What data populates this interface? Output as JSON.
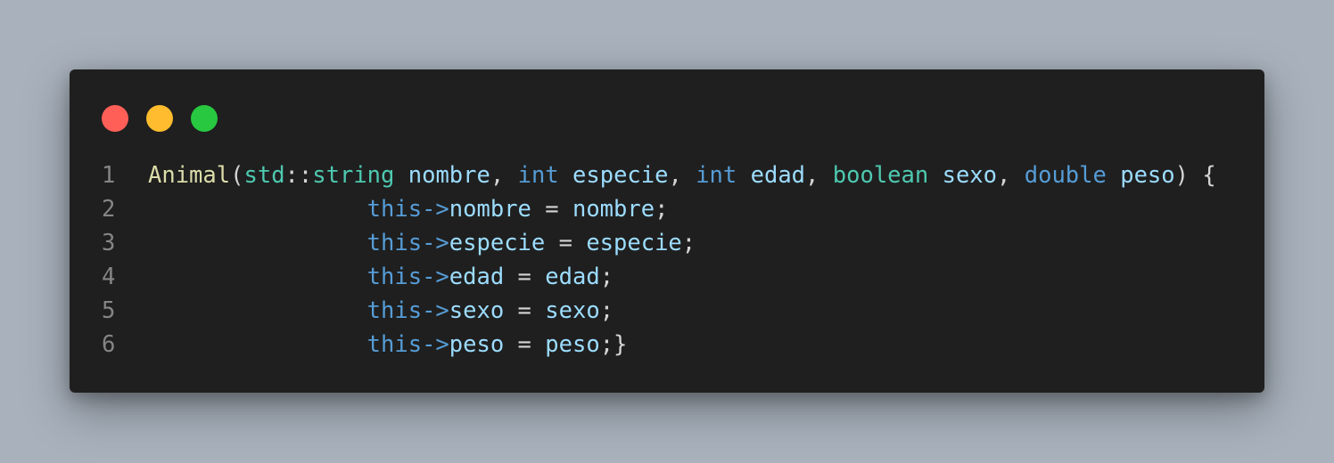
{
  "window": {
    "traffic_lights": {
      "close_color": "#ff5f57",
      "minimize_color": "#febc2e",
      "maximize_color": "#28c840"
    }
  },
  "code": {
    "lines": [
      {
        "number": "1",
        "tokens": [
          {
            "text": "Animal",
            "kind": "fn"
          },
          {
            "text": "(",
            "kind": "pl"
          },
          {
            "text": "std",
            "kind": "ty"
          },
          {
            "text": "::",
            "kind": "pl"
          },
          {
            "text": "string",
            "kind": "ty"
          },
          {
            "text": " ",
            "kind": "pl"
          },
          {
            "text": "nombre",
            "kind": "va"
          },
          {
            "text": ", ",
            "kind": "pl"
          },
          {
            "text": "int",
            "kind": "kw"
          },
          {
            "text": " ",
            "kind": "pl"
          },
          {
            "text": "especie",
            "kind": "va"
          },
          {
            "text": ", ",
            "kind": "pl"
          },
          {
            "text": "int",
            "kind": "kw"
          },
          {
            "text": " ",
            "kind": "pl"
          },
          {
            "text": "edad",
            "kind": "va"
          },
          {
            "text": ", ",
            "kind": "pl"
          },
          {
            "text": "boolean",
            "kind": "ty"
          },
          {
            "text": " ",
            "kind": "pl"
          },
          {
            "text": "sexo",
            "kind": "va"
          },
          {
            "text": ", ",
            "kind": "pl"
          },
          {
            "text": "double",
            "kind": "kw"
          },
          {
            "text": " ",
            "kind": "pl"
          },
          {
            "text": "peso",
            "kind": "va"
          },
          {
            "text": ") {",
            "kind": "pl"
          }
        ]
      },
      {
        "number": "2",
        "tokens": [
          {
            "text": "                ",
            "kind": "pl"
          },
          {
            "text": "this",
            "kind": "kw"
          },
          {
            "text": "->",
            "kind": "kw"
          },
          {
            "text": "nombre",
            "kind": "va"
          },
          {
            "text": " = ",
            "kind": "pl"
          },
          {
            "text": "nombre",
            "kind": "va"
          },
          {
            "text": ";",
            "kind": "pl"
          }
        ]
      },
      {
        "number": "3",
        "tokens": [
          {
            "text": "                ",
            "kind": "pl"
          },
          {
            "text": "this",
            "kind": "kw"
          },
          {
            "text": "->",
            "kind": "kw"
          },
          {
            "text": "especie",
            "kind": "va"
          },
          {
            "text": " = ",
            "kind": "pl"
          },
          {
            "text": "especie",
            "kind": "va"
          },
          {
            "text": ";",
            "kind": "pl"
          }
        ]
      },
      {
        "number": "4",
        "tokens": [
          {
            "text": "                ",
            "kind": "pl"
          },
          {
            "text": "this",
            "kind": "kw"
          },
          {
            "text": "->",
            "kind": "kw"
          },
          {
            "text": "edad",
            "kind": "va"
          },
          {
            "text": " = ",
            "kind": "pl"
          },
          {
            "text": "edad",
            "kind": "va"
          },
          {
            "text": ";",
            "kind": "pl"
          }
        ]
      },
      {
        "number": "5",
        "tokens": [
          {
            "text": "                ",
            "kind": "pl"
          },
          {
            "text": "this",
            "kind": "kw"
          },
          {
            "text": "->",
            "kind": "kw"
          },
          {
            "text": "sexo",
            "kind": "va"
          },
          {
            "text": " = ",
            "kind": "pl"
          },
          {
            "text": "sexo",
            "kind": "va"
          },
          {
            "text": ";",
            "kind": "pl"
          }
        ]
      },
      {
        "number": "6",
        "tokens": [
          {
            "text": "                ",
            "kind": "pl"
          },
          {
            "text": "this",
            "kind": "kw"
          },
          {
            "text": "->",
            "kind": "kw"
          },
          {
            "text": "peso",
            "kind": "va"
          },
          {
            "text": " = ",
            "kind": "pl"
          },
          {
            "text": "peso",
            "kind": "va"
          },
          {
            "text": ";}",
            "kind": "pl"
          }
        ]
      }
    ]
  }
}
